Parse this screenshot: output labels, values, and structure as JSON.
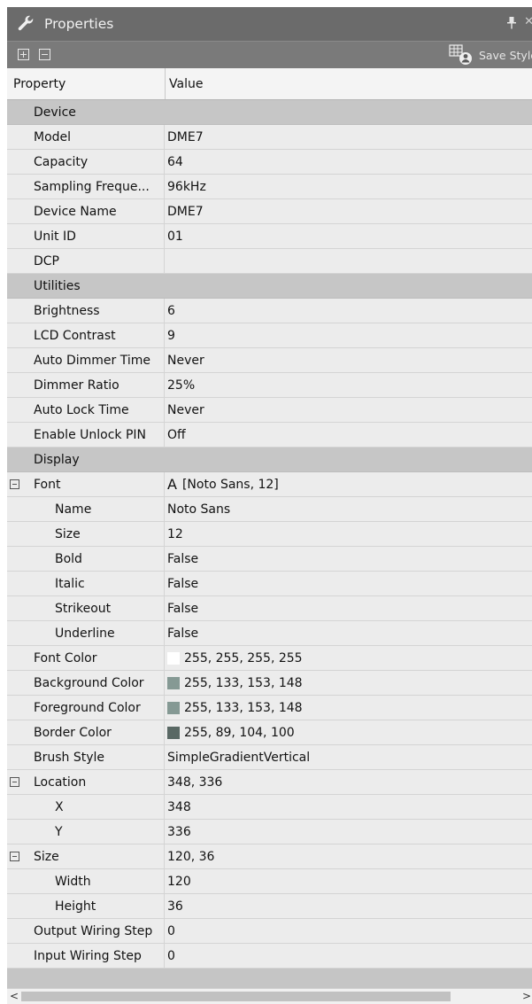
{
  "window": {
    "title": "Properties"
  },
  "toolbar": {
    "save_style_label": "Save Style"
  },
  "columns": {
    "property": "Property",
    "value": "Value"
  },
  "rows": [
    {
      "type": "category",
      "name": "Device"
    },
    {
      "name": "Model",
      "value": "DME7",
      "level": 0
    },
    {
      "name": "Capacity",
      "value": "64",
      "level": 0
    },
    {
      "name": "Sampling Freque...",
      "value": "96kHz",
      "level": 0
    },
    {
      "name": "Device Name",
      "value": "DME7",
      "level": 0
    },
    {
      "name": "Unit ID",
      "value": "01",
      "level": 0
    },
    {
      "name": "DCP",
      "value": "",
      "level": 0
    },
    {
      "type": "category",
      "name": "Utilities"
    },
    {
      "name": "Brightness",
      "value": "6",
      "level": 0
    },
    {
      "name": "LCD Contrast",
      "value": "9",
      "level": 0
    },
    {
      "name": "Auto Dimmer Time",
      "value": "Never",
      "level": 0
    },
    {
      "name": "Dimmer Ratio",
      "value": "25%",
      "level": 0
    },
    {
      "name": "Auto Lock Time",
      "value": "Never",
      "level": 0
    },
    {
      "name": "Enable Unlock PIN",
      "value": "Off",
      "level": 0
    },
    {
      "type": "category",
      "name": "Display"
    },
    {
      "name": "Font",
      "value": "[Noto Sans, 12]",
      "level": 0,
      "expander": true,
      "font_glyph": "A"
    },
    {
      "name": "Name",
      "value": "Noto Sans",
      "level": 1
    },
    {
      "name": "Size",
      "value": "12",
      "level": 1
    },
    {
      "name": "Bold",
      "value": "False",
      "level": 1
    },
    {
      "name": "Italic",
      "value": "False",
      "level": 1
    },
    {
      "name": "Strikeout",
      "value": "False",
      "level": 1
    },
    {
      "name": "Underline",
      "value": "False",
      "level": 1
    },
    {
      "name": "Font Color",
      "value": "255, 255, 255, 255",
      "level": 0,
      "swatch": "#ffffff"
    },
    {
      "name": "Background Color",
      "value": "255, 133, 153, 148",
      "level": 0,
      "swatch": "#859994"
    },
    {
      "name": "Foreground Color",
      "value": "255, 133, 153, 148",
      "level": 0,
      "swatch": "#859994"
    },
    {
      "name": "Border Color",
      "value": "255, 89, 104, 100",
      "level": 0,
      "swatch": "#596864"
    },
    {
      "name": "Brush Style",
      "value": "SimpleGradientVertical",
      "level": 0
    },
    {
      "name": "Location",
      "value": "348, 336",
      "level": 0,
      "expander": true
    },
    {
      "name": "X",
      "value": "348",
      "level": 1
    },
    {
      "name": "Y",
      "value": "336",
      "level": 1
    },
    {
      "name": "Size",
      "value": "120, 36",
      "level": 0,
      "expander": true
    },
    {
      "name": "Width",
      "value": "120",
      "level": 1
    },
    {
      "name": "Height",
      "value": "36",
      "level": 1
    },
    {
      "name": "Output Wiring Step",
      "value": "0",
      "level": 0
    },
    {
      "name": "Input Wiring Step",
      "value": "0",
      "level": 0
    }
  ],
  "colors": {
    "title_bar": "#6b6b6b",
    "toolbar": "#7a7a7a",
    "category_row": "#c6c6c6",
    "value_row": "#ececec"
  }
}
